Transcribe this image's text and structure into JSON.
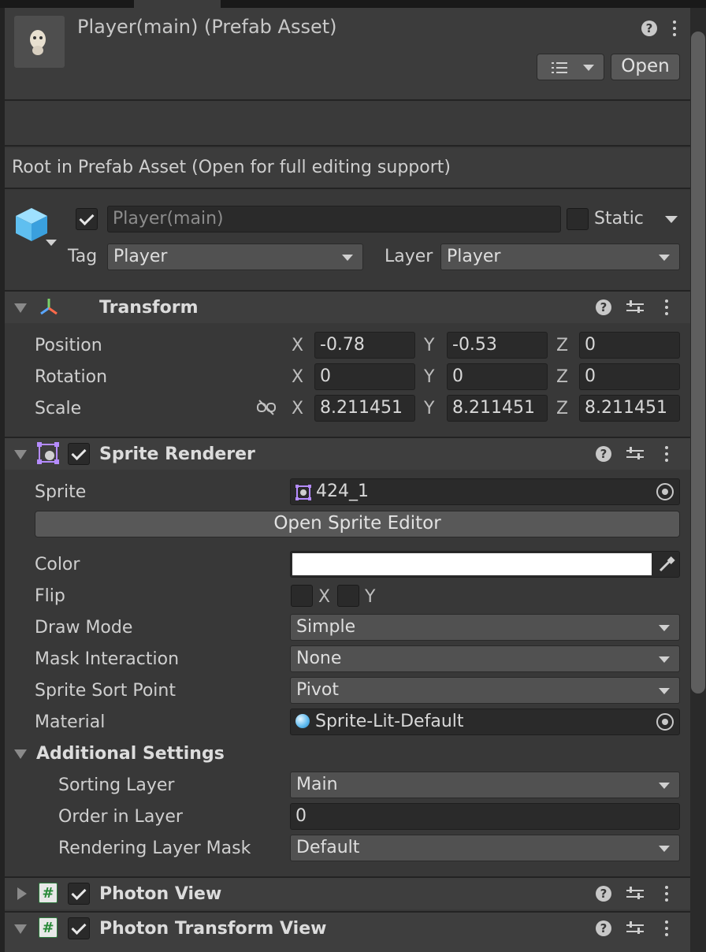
{
  "header": {
    "title": "Player(main) (Prefab Asset)",
    "open_button": "Open"
  },
  "root_note": "Root in Prefab Asset (Open for full editing support)",
  "gameobject": {
    "name": "Player(main)",
    "static_label": "Static",
    "tag_label": "Tag",
    "tag_value": "Player",
    "layer_label": "Layer",
    "layer_value": "Player"
  },
  "transform": {
    "title": "Transform",
    "rows": [
      {
        "label": "Position",
        "x": "-0.78",
        "y": "-0.53",
        "z": "0"
      },
      {
        "label": "Rotation",
        "x": "0",
        "y": "0",
        "z": "0"
      },
      {
        "label": "Scale",
        "x": "8.211451",
        "y": "8.211451",
        "z": "8.211451"
      }
    ],
    "axis_x": "X",
    "axis_y": "Y",
    "axis_z": "Z"
  },
  "sprite_renderer": {
    "title": "Sprite Renderer",
    "sprite_label": "Sprite",
    "sprite_value": "424_1",
    "open_sprite_editor": "Open Sprite Editor",
    "color_label": "Color",
    "color_value": "#ffffff",
    "flip_label": "Flip",
    "flip_x": "X",
    "flip_y": "Y",
    "draw_mode_label": "Draw Mode",
    "draw_mode_value": "Simple",
    "mask_label": "Mask Interaction",
    "mask_value": "None",
    "sort_point_label": "Sprite Sort Point",
    "sort_point_value": "Pivot",
    "material_label": "Material",
    "material_value": "Sprite-Lit-Default",
    "additional_settings": "Additional Settings",
    "sorting_layer_label": "Sorting Layer",
    "sorting_layer_value": "Main",
    "order_label": "Order in Layer",
    "order_value": "0",
    "rlm_label": "Rendering Layer Mask",
    "rlm_value": "Default"
  },
  "photon_view": {
    "title": "Photon View"
  },
  "photon_transform_view": {
    "title": "Photon Transform View"
  },
  "icons": [
    "prefab-thumbnail",
    "help-icon",
    "kebab-icon",
    "preset-icon",
    "cube-icon",
    "transform-icon",
    "sprite-renderer-icon",
    "script-icon",
    "link-icon",
    "object-picker-icon",
    "eyedropper-icon"
  ],
  "colors": {
    "background": "#383838",
    "field": "#2a2a2a",
    "dropdown": "#515151",
    "header": "#3e3e3e"
  }
}
